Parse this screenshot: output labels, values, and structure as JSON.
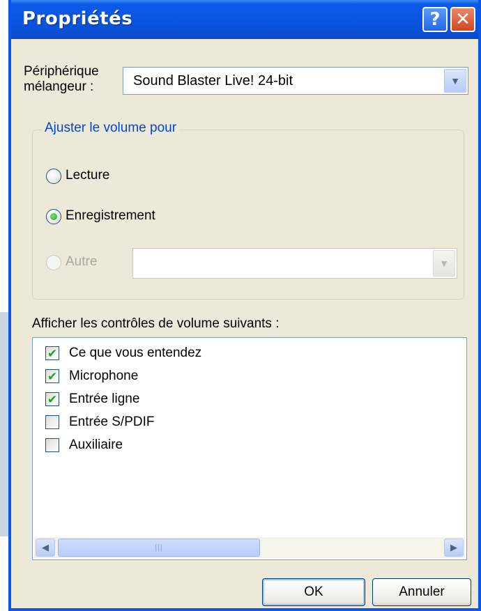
{
  "window": {
    "title": "Propriétés",
    "help_glyph": "?",
    "close_glyph": "✕"
  },
  "mixer": {
    "label_line1": "Périphérique",
    "label_line2": "mélangeur :",
    "selected": "Sound Blaster Live! 24-bit"
  },
  "volume_group": {
    "legend": "Ajuster le volume pour",
    "options": [
      {
        "label": "Lecture",
        "checked": false,
        "enabled": true
      },
      {
        "label": "Enregistrement",
        "checked": true,
        "enabled": true
      },
      {
        "label": "Autre",
        "checked": false,
        "enabled": false
      }
    ],
    "other_device": ""
  },
  "controls": {
    "heading": "Afficher les contrôles de volume suivants :",
    "items": [
      {
        "label": "Ce que vous entendez",
        "checked": true
      },
      {
        "label": "Microphone",
        "checked": true
      },
      {
        "label": "Entrée ligne",
        "checked": true
      },
      {
        "label": "Entrée S/PDIF",
        "checked": false
      },
      {
        "label": "Auxiliaire",
        "checked": false
      }
    ]
  },
  "buttons": {
    "ok": "OK",
    "cancel": "Annuler"
  },
  "icons": {
    "dropdown": "chevron-down-icon",
    "scroll_left": "arrow-left-icon",
    "scroll_right": "arrow-right-icon",
    "check": "checkmark-icon"
  },
  "colors": {
    "title_bar": "#0a55e1",
    "dialog_bg": "#ece9d8",
    "group_legend": "#0046d5",
    "check_green": "#21a121"
  }
}
